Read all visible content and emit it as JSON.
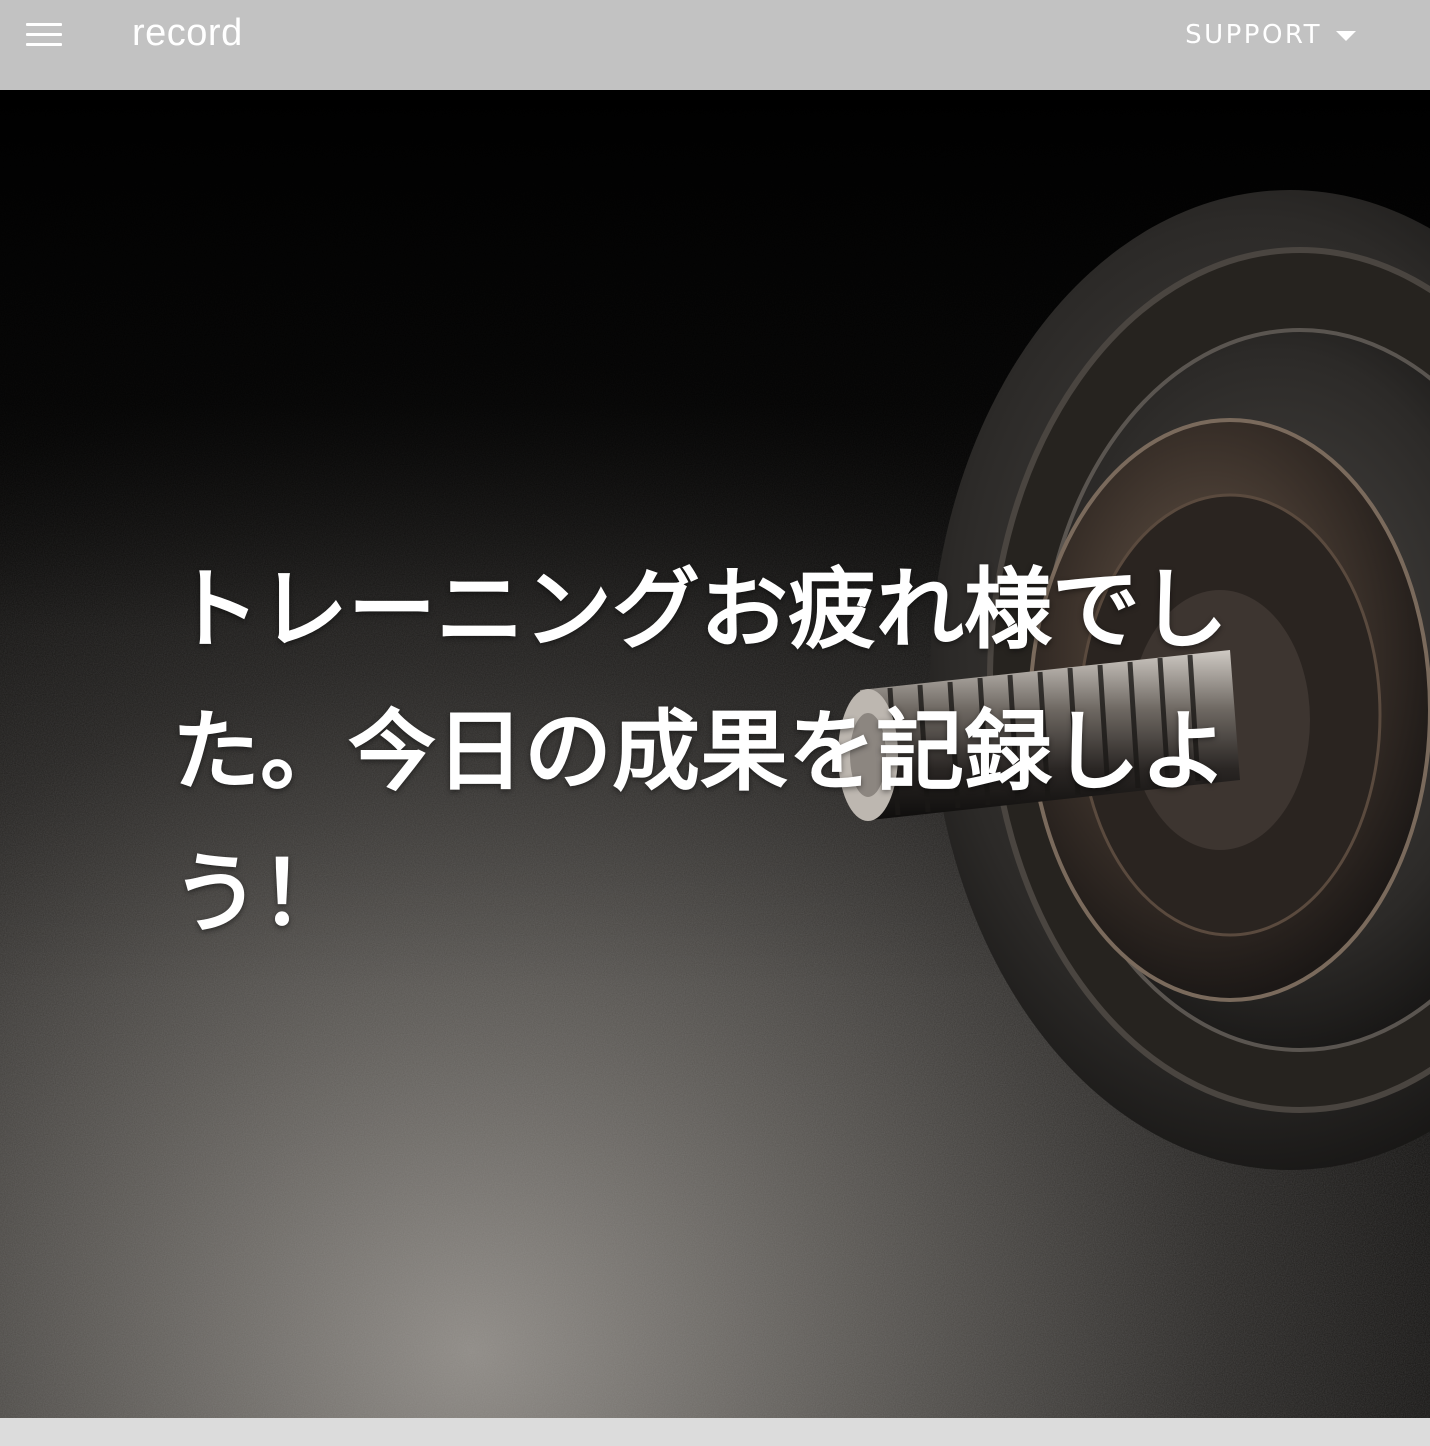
{
  "appbar": {
    "title": "record",
    "support_label": "SUPPORT",
    "menu_icon": "hamburger-menu-icon",
    "support_icon": "caret-down-icon",
    "background": "#c2c2c2"
  },
  "hero": {
    "headline": "トレーニングお疲れ様でした。今日の成果を記録しよう！",
    "image": "dumbbell-plate-photo"
  }
}
